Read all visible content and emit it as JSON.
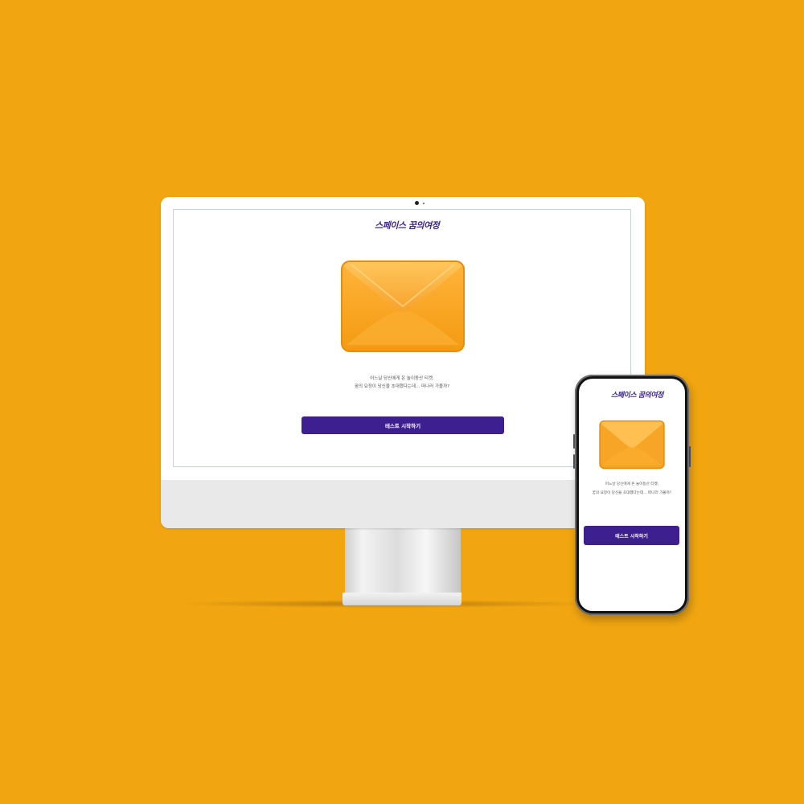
{
  "brand": {
    "logo_text": "스페이스 꿈의여정"
  },
  "intro": {
    "line1": "어느날 당신에게 온 놀이동산 티켓,",
    "line2": "꿈의 요정이 당신을 초대했다는데... 떠나러 가볼까?"
  },
  "actions": {
    "start_label": "테스트 시작하기"
  },
  "colors": {
    "background": "#F0A511",
    "accent": "#3D1F8F",
    "envelope": "#FFA51F"
  },
  "icons": {
    "envelope": "envelope-icon"
  }
}
